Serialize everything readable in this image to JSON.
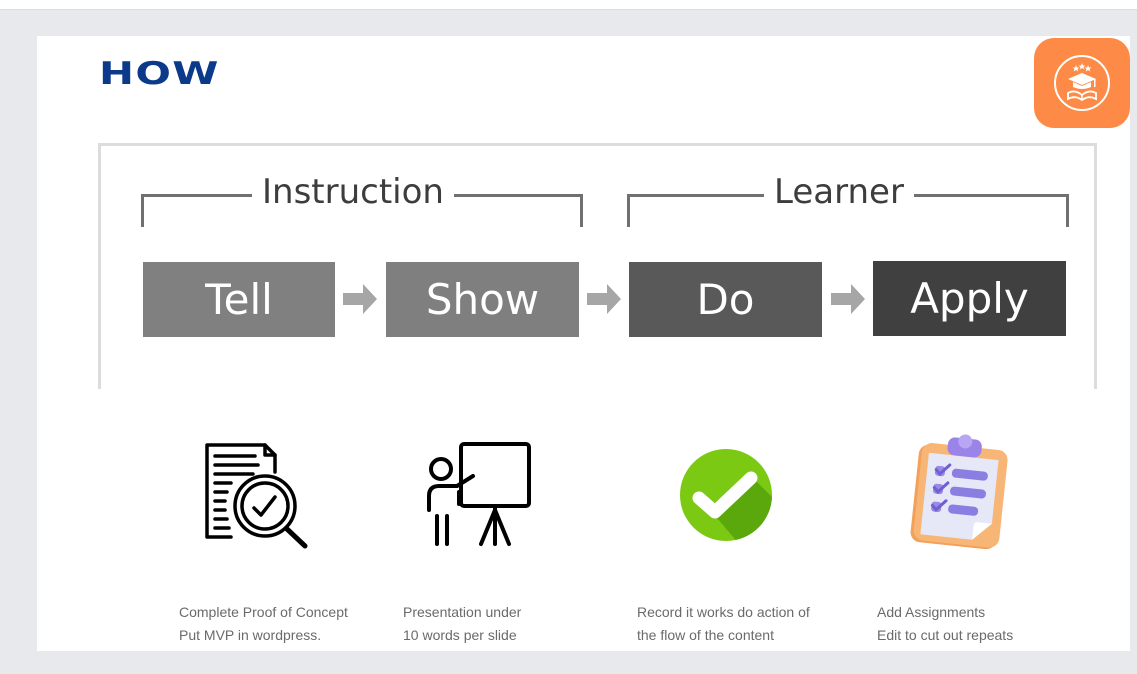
{
  "slide": {
    "title": "HOW",
    "badge_icon": "graduation-cap-book-icon",
    "colors": {
      "title": "#0b3a8a",
      "badge": "#fd8b47",
      "tell": "#808080",
      "show": "#7f7f7f",
      "do": "#595959",
      "apply": "#404040",
      "arrow": "#a6a6a6"
    }
  },
  "diagram": {
    "groups": [
      {
        "label": "Instruction"
      },
      {
        "label": "Learner"
      }
    ],
    "steps": [
      {
        "label": "Tell"
      },
      {
        "label": "Show"
      },
      {
        "label": "Do"
      },
      {
        "label": "Apply"
      }
    ]
  },
  "columns": [
    {
      "icon": "document-search-check-icon",
      "lines": [
        "Complete Proof of Concept",
        "Put MVP in wordpress."
      ]
    },
    {
      "icon": "presenter-board-icon",
      "lines": [
        "Presentation under",
        "10 words per slide"
      ]
    },
    {
      "icon": "green-check-circle-icon",
      "lines": [
        "Record it works do action of",
        "the flow of the content"
      ]
    },
    {
      "icon": "clipboard-checklist-icon",
      "lines": [
        "Add Assignments",
        "Edit to cut out repeats"
      ]
    }
  ]
}
